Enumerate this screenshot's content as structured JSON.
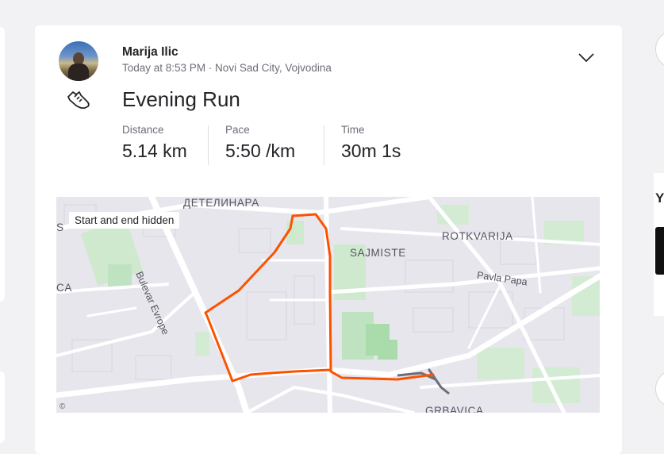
{
  "activity": {
    "athlete_name": "Marija Ilic",
    "meta": "Today at 8:53 PM · Novi Sad City, Vojvodina",
    "title": "Evening Run",
    "sport_icon": "running-shoe-icon",
    "stats": [
      {
        "label": "Distance",
        "value": "5.14 km"
      },
      {
        "label": "Pace",
        "value": "5:50 /km"
      },
      {
        "label": "Time",
        "value": "30m 1s"
      }
    ],
    "map": {
      "privacy_badge": "Start and end hidden",
      "labels": {
        "detelinara": "ДЕТЕЛИНАРА",
        "rotkvarija": "ROTKVARIJA",
        "sajmiste": "SAJMISTE",
        "grbavica": "GRBAVICA",
        "bulevar": "Bulevar Evrope",
        "pavla_papa": "Pavla Papa",
        "edge_left_top": "S",
        "edge_left_mid": "CA"
      },
      "route_color": "#fc5200",
      "hidden_route_color": "#6d6d78"
    }
  },
  "right_rail": {
    "heading_fragment": "Y"
  }
}
